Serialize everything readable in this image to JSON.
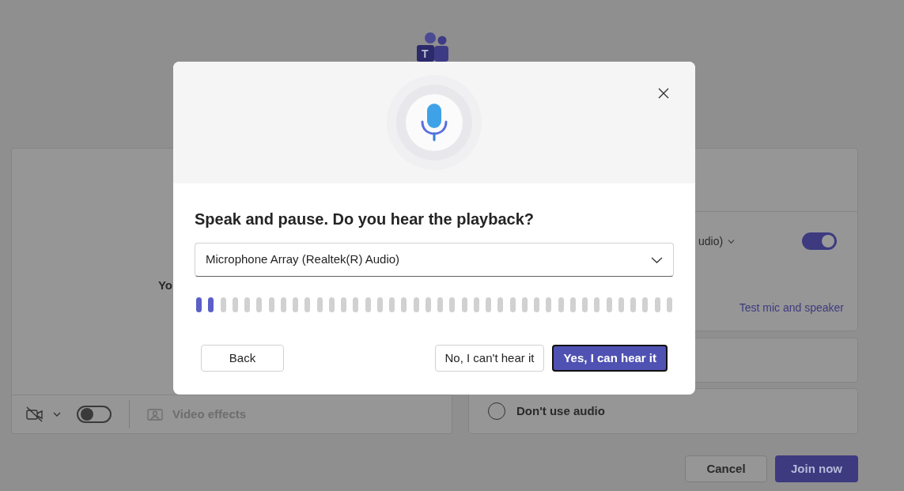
{
  "app_logo": {
    "letter": "T"
  },
  "video_panel": {
    "name_partial": "Yo",
    "camera_on": false,
    "effects_label": "Video effects"
  },
  "audio_panel": {
    "device_partial": "udio)",
    "mic_on": true,
    "test_link": "Test mic and speaker",
    "options": [
      {
        "label": "Don't use audio",
        "selected": false
      }
    ]
  },
  "footer_buttons": [
    {
      "label": "Cancel",
      "kind": "secondary"
    },
    {
      "label": "Join now",
      "kind": "primary"
    }
  ],
  "dialog": {
    "title": "Speak and pause. Do you hear the playback?",
    "device": "Microphone Array (Realtek(R) Audio)",
    "meter": {
      "level": 0.05
    },
    "buttons": [
      {
        "label": "Back",
        "kind": "back"
      },
      {
        "label": "No, I can't hear it",
        "kind": "secondary"
      },
      {
        "label": "Yes, I can hear it",
        "kind": "primary"
      }
    ]
  }
}
